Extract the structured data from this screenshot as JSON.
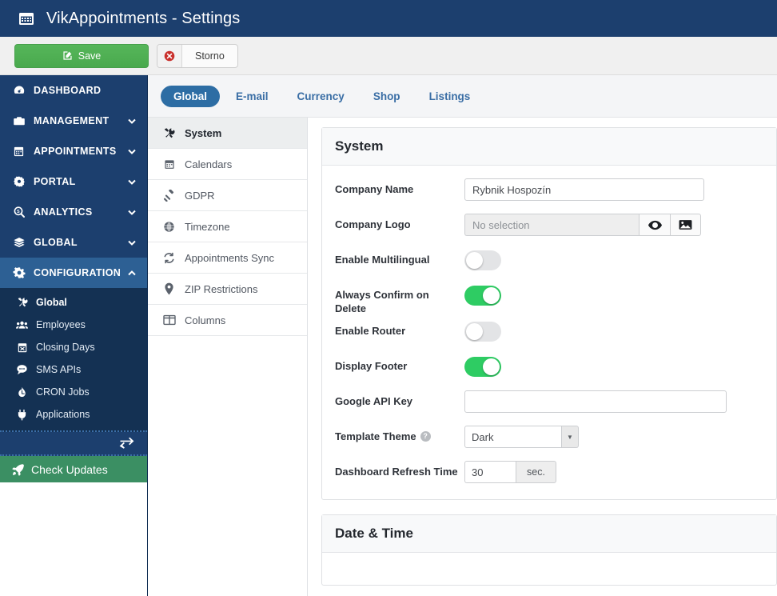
{
  "header": {
    "title": "VikAppointments - Settings",
    "icon": "calendar-icon",
    "bg_color": "#1c3f6e"
  },
  "toolbar": {
    "save_label": "Save",
    "save_icon": "edit-square-icon",
    "save_color": "#4caf50",
    "cancel_label": "Storno",
    "cancel_icon": "error-circle-icon",
    "cancel_icon_color": "#c9302c"
  },
  "sidebar": {
    "items": [
      {
        "label": "DASHBOARD",
        "icon": "dashboard-gauge-icon",
        "caret": "",
        "active": false
      },
      {
        "label": "MANAGEMENT",
        "icon": "briefcase-icon",
        "caret": "down",
        "active": false
      },
      {
        "label": "APPOINTMENTS",
        "icon": "calendar-icon",
        "caret": "down",
        "active": false
      },
      {
        "label": "PORTAL",
        "icon": "gear-badge-icon",
        "caret": "down",
        "active": false
      },
      {
        "label": "ANALYTICS",
        "icon": "search-stats-icon",
        "caret": "down",
        "active": false
      },
      {
        "label": "GLOBAL",
        "icon": "layers-icon",
        "caret": "down",
        "active": false
      },
      {
        "label": "CONFIGURATION",
        "icon": "gear-icon",
        "caret": "up",
        "active": true
      }
    ],
    "submenu": [
      {
        "label": "Global",
        "icon": "tools-icon",
        "active": true
      },
      {
        "label": "Employees",
        "icon": "users-icon",
        "active": false
      },
      {
        "label": "Closing Days",
        "icon": "calendar-x-icon",
        "active": false
      },
      {
        "label": "SMS APIs",
        "icon": "chat-bubble-icon",
        "active": false
      },
      {
        "label": "CRON Jobs",
        "icon": "clock-icon",
        "active": false
      },
      {
        "label": "Applications",
        "icon": "plug-icon",
        "active": false
      }
    ],
    "collapse_icon": "exchange-arrows-icon",
    "check_updates_label": "Check Updates",
    "check_updates_icon": "rocket-icon",
    "check_updates_color": "#3b8f63"
  },
  "main": {
    "tabs": [
      {
        "label": "Global",
        "active": true
      },
      {
        "label": "E-mail",
        "active": false
      },
      {
        "label": "Currency",
        "active": false
      },
      {
        "label": "Shop",
        "active": false
      },
      {
        "label": "Listings",
        "active": false
      }
    ],
    "inner_nav": [
      {
        "label": "System",
        "icon": "tools-icon",
        "active": true
      },
      {
        "label": "Calendars",
        "icon": "calendar-icon",
        "active": false
      },
      {
        "label": "GDPR",
        "icon": "gavel-icon",
        "active": false
      },
      {
        "label": "Timezone",
        "icon": "globe-icon",
        "active": false
      },
      {
        "label": "Appointments Sync",
        "icon": "sync-icon",
        "active": false
      },
      {
        "label": "ZIP Restrictions",
        "icon": "map-pin-icon",
        "active": false
      },
      {
        "label": "Columns",
        "icon": "columns-icon",
        "active": false
      }
    ],
    "system_card": {
      "title": "System",
      "fields": {
        "company_name": {
          "label": "Company Name",
          "value": "Rybnik Hospozín",
          "placeholder": ""
        },
        "company_logo": {
          "label": "Company Logo",
          "value": "",
          "placeholder": "No selection",
          "preview_icon": "eye-icon",
          "browse_icon": "image-icon"
        },
        "enable_multilingual": {
          "label": "Enable Multilingual",
          "on": false
        },
        "always_confirm_on_delete": {
          "label": "Always Confirm on Delete",
          "on": true
        },
        "enable_router": {
          "label": "Enable Router",
          "on": false
        },
        "display_footer": {
          "label": "Display Footer",
          "on": true
        },
        "google_api_key": {
          "label": "Google API Key",
          "value": "",
          "placeholder": ""
        },
        "template_theme": {
          "label": "Template Theme",
          "value": "Dark",
          "help_icon": "question-mark-icon",
          "options": [
            "Dark"
          ]
        },
        "dashboard_refresh_time": {
          "label": "Dashboard Refresh Time",
          "value": "30",
          "unit": "sec."
        }
      }
    },
    "datetime_card": {
      "title": "Date & Time"
    }
  },
  "colors": {
    "brand_dark_blue": "#1c3f6e",
    "accent_blue": "#2d6da4",
    "toggle_on_green": "#2ecc63",
    "save_green": "#4caf50"
  }
}
